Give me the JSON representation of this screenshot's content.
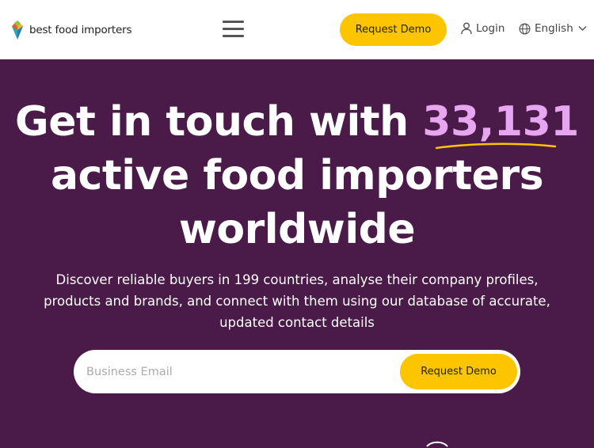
{
  "header": {
    "logo_text": "best food importers",
    "request_demo_label": "Request Demo",
    "login_label": "Login",
    "language_label": "English"
  },
  "hero": {
    "title_part1": "Get in touch with ",
    "importer_count": "33,131",
    "title_part2": "active food importers worldwide",
    "subtitle": "Discover reliable buyers in 199 countries, analyse their company profiles, products and brands, and connect with them using our database of accurate, updated contact details"
  },
  "form": {
    "email_placeholder": "Business Email",
    "email_value": "",
    "submit_label": "Request Demo"
  },
  "colors": {
    "background": "#4a1a48",
    "accent": "#fdc500",
    "highlight": "#e6a7f0",
    "header_bg": "#ffffff"
  },
  "icons": [
    "logo-icon",
    "hamburger-menu-icon",
    "user-icon",
    "globe-icon",
    "chevron-down-icon"
  ]
}
